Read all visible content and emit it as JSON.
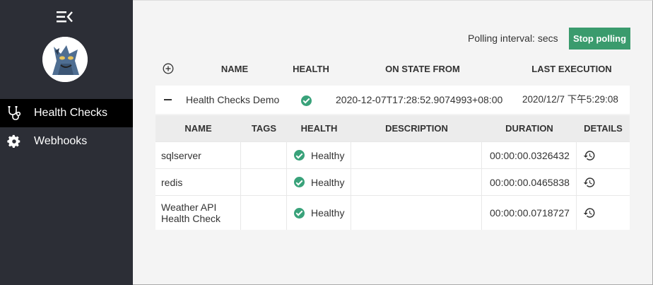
{
  "sidebar": {
    "menu_icon": "menu-collapse-icon",
    "avatar_icon": "app-logo-icon",
    "items": [
      {
        "label": "Health Checks",
        "icon": "stethoscope-icon",
        "active": true
      },
      {
        "label": "Webhooks",
        "icon": "gear-icon",
        "active": false
      }
    ]
  },
  "toolbar": {
    "polling_label": "Polling interval: secs",
    "stop_label": "Stop polling",
    "stop_color": "#3a9b6d"
  },
  "top_table": {
    "add_icon": "add-circle-icon",
    "columns": [
      "NAME",
      "HEALTH",
      "ON STATE FROM",
      "LAST EXECUTION"
    ],
    "group": {
      "name": "Health Checks Demo",
      "health": "Healthy",
      "on_state_from": "2020-12-07T17:28:52.9074993+08:00",
      "last_execution": "2020/12/7 下午5:29:08"
    }
  },
  "details_table": {
    "columns": [
      "NAME",
      "TAGS",
      "HEALTH",
      "DESCRIPTION",
      "DURATION",
      "DETAILS"
    ],
    "rows": [
      {
        "name": "sqlserver",
        "tags": "",
        "health": "Healthy",
        "description": "",
        "duration": "00:00:00.0326432"
      },
      {
        "name": "redis",
        "tags": "",
        "health": "Healthy",
        "description": "",
        "duration": "00:00:00.0465838"
      },
      {
        "name": "Weather API Health Check",
        "tags": "",
        "health": "Healthy",
        "description": "",
        "duration": "00:00:00.0718727"
      }
    ]
  },
  "colors": {
    "sidebar_bg": "#2c2e36",
    "active_nav_bg": "#000000",
    "healthy": "#39a27a"
  }
}
